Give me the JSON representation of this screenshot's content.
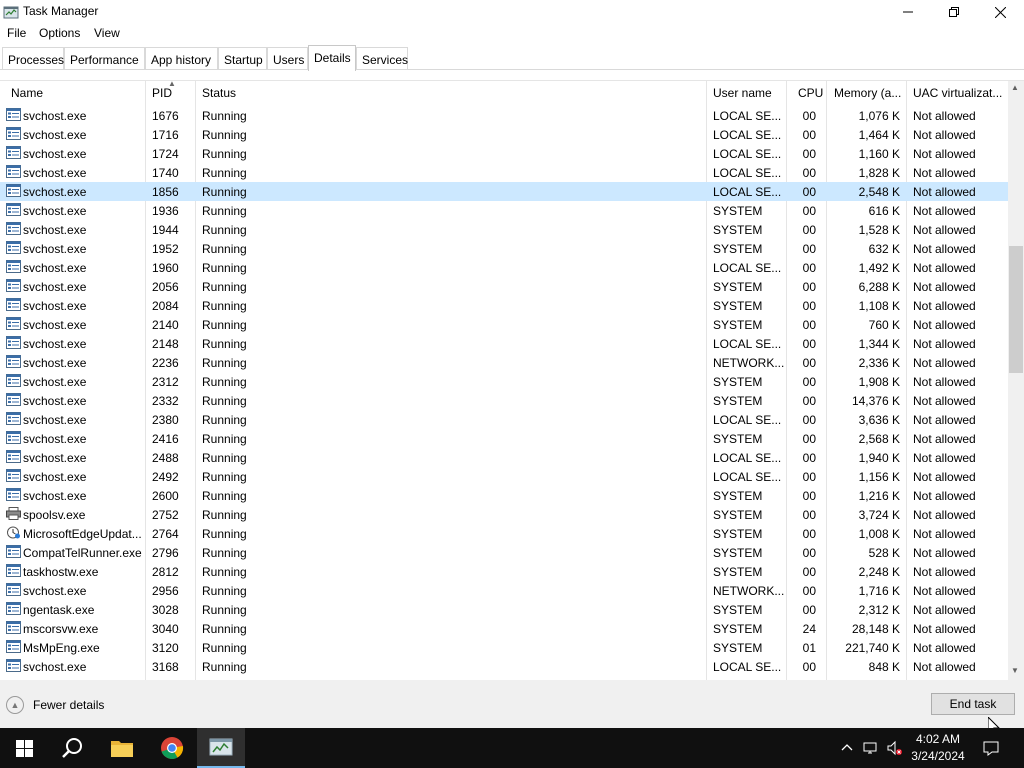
{
  "window": {
    "title": "Task Manager"
  },
  "menu": [
    "File",
    "Options",
    "View"
  ],
  "tabs": [
    {
      "label": "Processes",
      "active": false
    },
    {
      "label": "Performance",
      "active": false
    },
    {
      "label": "App history",
      "active": false
    },
    {
      "label": "Startup",
      "active": false
    },
    {
      "label": "Users",
      "active": false
    },
    {
      "label": "Details",
      "active": true
    },
    {
      "label": "Services",
      "active": false
    }
  ],
  "columns": {
    "name": "Name",
    "pid": "PID",
    "status": "Status",
    "user": "User name",
    "cpu": "CPU",
    "memory": "Memory (a...",
    "uac": "UAC virtualizat..."
  },
  "sort": {
    "column": "PID",
    "direction": "ascending"
  },
  "rows": [
    {
      "name": "svchost.exe",
      "pid": "1676",
      "status": "Running",
      "user": "LOCAL SE...",
      "cpu": "00",
      "memory": "1,076 K",
      "uac": "Not allowed",
      "icon": "service-window-icon"
    },
    {
      "name": "svchost.exe",
      "pid": "1716",
      "status": "Running",
      "user": "LOCAL SE...",
      "cpu": "00",
      "memory": "1,464 K",
      "uac": "Not allowed",
      "icon": "service-window-icon"
    },
    {
      "name": "svchost.exe",
      "pid": "1724",
      "status": "Running",
      "user": "LOCAL SE...",
      "cpu": "00",
      "memory": "1,160 K",
      "uac": "Not allowed",
      "icon": "service-window-icon"
    },
    {
      "name": "svchost.exe",
      "pid": "1740",
      "status": "Running",
      "user": "LOCAL SE...",
      "cpu": "00",
      "memory": "1,828 K",
      "uac": "Not allowed",
      "icon": "service-window-icon"
    },
    {
      "name": "svchost.exe",
      "pid": "1856",
      "status": "Running",
      "user": "LOCAL SE...",
      "cpu": "00",
      "memory": "2,548 K",
      "uac": "Not allowed",
      "icon": "service-window-icon",
      "selected": true
    },
    {
      "name": "svchost.exe",
      "pid": "1936",
      "status": "Running",
      "user": "SYSTEM",
      "cpu": "00",
      "memory": "616 K",
      "uac": "Not allowed",
      "icon": "service-window-icon"
    },
    {
      "name": "svchost.exe",
      "pid": "1944",
      "status": "Running",
      "user": "SYSTEM",
      "cpu": "00",
      "memory": "1,528 K",
      "uac": "Not allowed",
      "icon": "service-window-icon"
    },
    {
      "name": "svchost.exe",
      "pid": "1952",
      "status": "Running",
      "user": "SYSTEM",
      "cpu": "00",
      "memory": "632 K",
      "uac": "Not allowed",
      "icon": "service-window-icon"
    },
    {
      "name": "svchost.exe",
      "pid": "1960",
      "status": "Running",
      "user": "LOCAL SE...",
      "cpu": "00",
      "memory": "1,492 K",
      "uac": "Not allowed",
      "icon": "service-window-icon"
    },
    {
      "name": "svchost.exe",
      "pid": "2056",
      "status": "Running",
      "user": "SYSTEM",
      "cpu": "00",
      "memory": "6,288 K",
      "uac": "Not allowed",
      "icon": "service-window-icon"
    },
    {
      "name": "svchost.exe",
      "pid": "2084",
      "status": "Running",
      "user": "SYSTEM",
      "cpu": "00",
      "memory": "1,108 K",
      "uac": "Not allowed",
      "icon": "service-window-icon"
    },
    {
      "name": "svchost.exe",
      "pid": "2140",
      "status": "Running",
      "user": "SYSTEM",
      "cpu": "00",
      "memory": "760 K",
      "uac": "Not allowed",
      "icon": "service-window-icon"
    },
    {
      "name": "svchost.exe",
      "pid": "2148",
      "status": "Running",
      "user": "LOCAL SE...",
      "cpu": "00",
      "memory": "1,344 K",
      "uac": "Not allowed",
      "icon": "service-window-icon"
    },
    {
      "name": "svchost.exe",
      "pid": "2236",
      "status": "Running",
      "user": "NETWORK...",
      "cpu": "00",
      "memory": "2,336 K",
      "uac": "Not allowed",
      "icon": "service-window-icon"
    },
    {
      "name": "svchost.exe",
      "pid": "2312",
      "status": "Running",
      "user": "SYSTEM",
      "cpu": "00",
      "memory": "1,908 K",
      "uac": "Not allowed",
      "icon": "service-window-icon"
    },
    {
      "name": "svchost.exe",
      "pid": "2332",
      "status": "Running",
      "user": "SYSTEM",
      "cpu": "00",
      "memory": "14,376 K",
      "uac": "Not allowed",
      "icon": "service-window-icon"
    },
    {
      "name": "svchost.exe",
      "pid": "2380",
      "status": "Running",
      "user": "LOCAL SE...",
      "cpu": "00",
      "memory": "3,636 K",
      "uac": "Not allowed",
      "icon": "service-window-icon"
    },
    {
      "name": "svchost.exe",
      "pid": "2416",
      "status": "Running",
      "user": "SYSTEM",
      "cpu": "00",
      "memory": "2,568 K",
      "uac": "Not allowed",
      "icon": "service-window-icon"
    },
    {
      "name": "svchost.exe",
      "pid": "2488",
      "status": "Running",
      "user": "LOCAL SE...",
      "cpu": "00",
      "memory": "1,940 K",
      "uac": "Not allowed",
      "icon": "service-window-icon"
    },
    {
      "name": "svchost.exe",
      "pid": "2492",
      "status": "Running",
      "user": "LOCAL SE...",
      "cpu": "00",
      "memory": "1,156 K",
      "uac": "Not allowed",
      "icon": "service-window-icon"
    },
    {
      "name": "svchost.exe",
      "pid": "2600",
      "status": "Running",
      "user": "SYSTEM",
      "cpu": "00",
      "memory": "1,216 K",
      "uac": "Not allowed",
      "icon": "service-window-icon"
    },
    {
      "name": "spoolsv.exe",
      "pid": "2752",
      "status": "Running",
      "user": "SYSTEM",
      "cpu": "00",
      "memory": "3,724 K",
      "uac": "Not allowed",
      "icon": "printer-icon"
    },
    {
      "name": "MicrosoftEdgeUpdat...",
      "pid": "2764",
      "status": "Running",
      "user": "SYSTEM",
      "cpu": "00",
      "memory": "1,008 K",
      "uac": "Not allowed",
      "icon": "edge-update-icon"
    },
    {
      "name": "CompatTelRunner.exe",
      "pid": "2796",
      "status": "Running",
      "user": "SYSTEM",
      "cpu": "00",
      "memory": "528 K",
      "uac": "Not allowed",
      "icon": "service-window-icon"
    },
    {
      "name": "taskhostw.exe",
      "pid": "2812",
      "status": "Running",
      "user": "SYSTEM",
      "cpu": "00",
      "memory": "2,248 K",
      "uac": "Not allowed",
      "icon": "service-window-icon"
    },
    {
      "name": "svchost.exe",
      "pid": "2956",
      "status": "Running",
      "user": "NETWORK...",
      "cpu": "00",
      "memory": "1,716 K",
      "uac": "Not allowed",
      "icon": "service-window-icon"
    },
    {
      "name": "ngentask.exe",
      "pid": "3028",
      "status": "Running",
      "user": "SYSTEM",
      "cpu": "00",
      "memory": "2,312 K",
      "uac": "Not allowed",
      "icon": "service-window-icon"
    },
    {
      "name": "mscorsvw.exe",
      "pid": "3040",
      "status": "Running",
      "user": "SYSTEM",
      "cpu": "24",
      "memory": "28,148 K",
      "uac": "Not allowed",
      "icon": "service-window-icon"
    },
    {
      "name": "MsMpEng.exe",
      "pid": "3120",
      "status": "Running",
      "user": "SYSTEM",
      "cpu": "01",
      "memory": "221,740 K",
      "uac": "Not allowed",
      "icon": "service-window-icon"
    },
    {
      "name": "svchost.exe",
      "pid": "3168",
      "status": "Running",
      "user": "LOCAL SE...",
      "cpu": "00",
      "memory": "848 K",
      "uac": "Not allowed",
      "icon": "service-window-icon"
    }
  ],
  "footer": {
    "fewer_details": "Fewer details",
    "end_task": "End task"
  },
  "taskbar": {
    "apps": [
      "windows-start-icon",
      "search-icon",
      "file-explorer-icon",
      "chrome-icon",
      "task-manager-icon"
    ],
    "active_app": "task-manager-icon",
    "time": "4:02 AM",
    "date": "3/24/2024"
  },
  "colors": {
    "selected_row": "#cce8ff",
    "taskbar": "#101010",
    "footer": "#f0f0f0"
  }
}
